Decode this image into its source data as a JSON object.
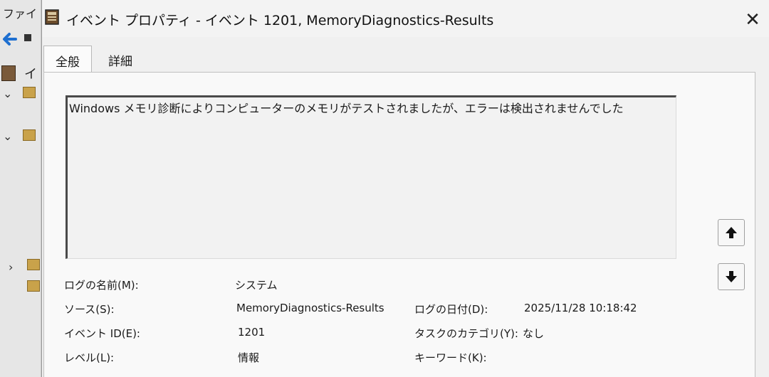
{
  "background_app": {
    "menu_text": "ファイ",
    "tree_letter": "イ"
  },
  "dialog": {
    "title": "イベント プロパティ - イベント 1201, MemoryDiagnostics-Results",
    "close_glyph": "✕",
    "tabs": [
      {
        "label": "全般",
        "selected": true
      },
      {
        "label": "詳細",
        "selected": false
      }
    ],
    "description": "Windows メモリ診断によりコンピューターのメモリがテストされましたが、エラーは検出されませんでした",
    "fields": {
      "log_name_label": "ログの名前(M):",
      "log_name_value": "システム",
      "source_label": "ソース(S):",
      "source_value": "MemoryDiagnostics-Results",
      "logged_label": "ログの日付(D):",
      "logged_value": "2025/11/28 10:18:42",
      "event_id_label": "イベント ID(E):",
      "event_id_value": "1201",
      "task_category_label": "タスクのカテゴリ(Y):",
      "task_category_value": "なし",
      "level_label": "レベル(L):",
      "level_value": "情報",
      "keywords_label": "キーワード(K):"
    }
  },
  "icons": {
    "title": "event-log-icon",
    "close": "close-icon",
    "scroll_up": "arrow-up-icon",
    "scroll_down": "arrow-down-icon",
    "back": "back-arrow-icon"
  },
  "colors": {
    "accent": "#1e6fd0",
    "dialog_bg": "#f0f0f0"
  }
}
